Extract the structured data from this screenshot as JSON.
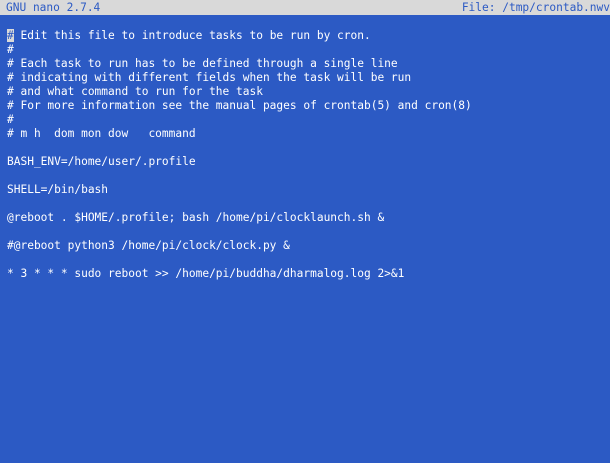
{
  "titlebar": {
    "app": "GNU nano 2.7.4",
    "file": "File: /tmp/crontab.nwv"
  },
  "editor": {
    "cursor_char": "#",
    "lines": [
      " Edit this file to introduce tasks to be run by cron.",
      "#",
      "# Each task to run has to be defined through a single line",
      "# indicating with different fields when the task will be run",
      "# and what command to run for the task",
      "# For more information see the manual pages of crontab(5) and cron(8)",
      "#",
      "# m h  dom mon dow   command",
      "",
      "BASH_ENV=/home/user/.profile",
      "",
      "SHELL=/bin/bash",
      "",
      "@reboot . $HOME/.profile; bash /home/pi/clocklaunch.sh &",
      "",
      "#@reboot python3 /home/pi/clock/clock.py &",
      "",
      "* 3 * * * sudo reboot >> /home/pi/buddha/dharmalog.log 2>&1"
    ]
  }
}
